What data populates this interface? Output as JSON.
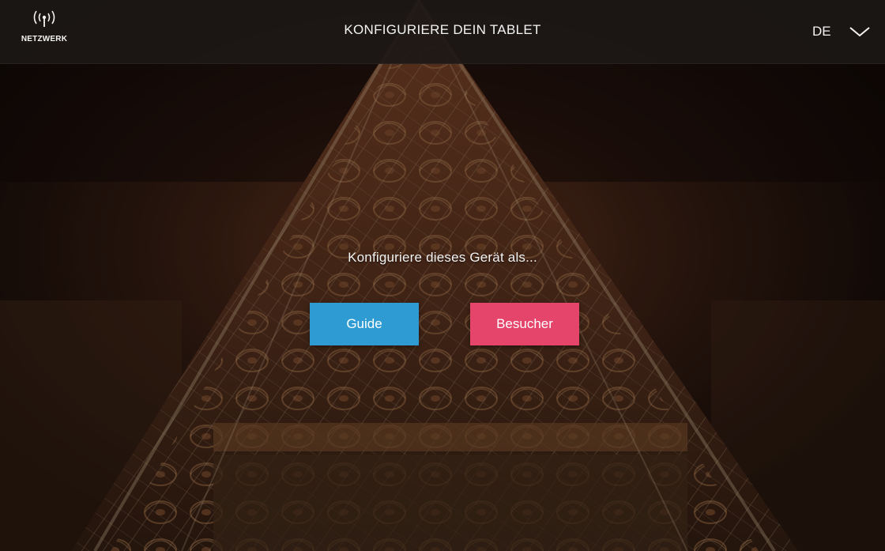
{
  "header": {
    "title": "KONFIGURIERE DEIN TABLET",
    "network_label": "NETZWERK",
    "network_icon": "antenna-signal-icon",
    "language_code": "DE",
    "language_icon": "chevron-down-icon"
  },
  "main": {
    "prompt": "Konfiguriere dieses Gerät als...",
    "guide_label": "Guide",
    "visitor_label": "Besucher"
  },
  "colors": {
    "guide_button": "#2e9bd3",
    "visitor_button": "#e5446b",
    "topbar": "#1c1816"
  }
}
